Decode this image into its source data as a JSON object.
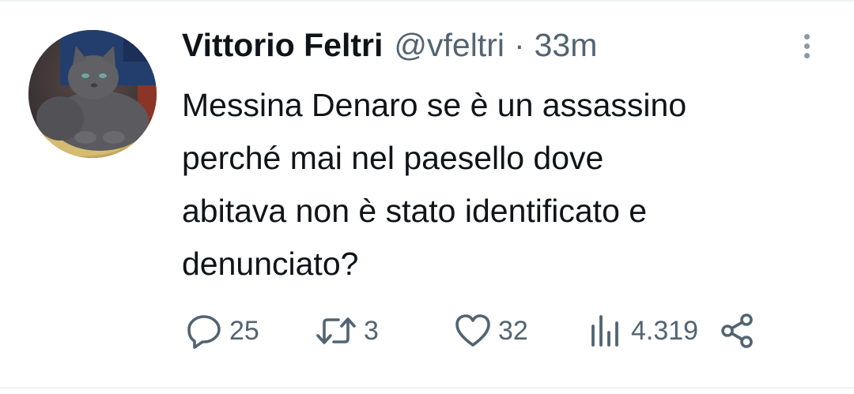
{
  "tweet": {
    "author": {
      "display_name": "Vittorio Feltri",
      "handle": "@vfeltri",
      "avatar_icon": "cat-photo-avatar"
    },
    "separator": "·",
    "timestamp": "33m",
    "text": "Messina Denaro se è un assassino\nperché mai nel paesello dove\nabitava non è stato identificato e\ndenunciato?",
    "menu_icon": "more-vertical-icon",
    "actions": {
      "reply": {
        "icon": "reply-icon",
        "count": "25"
      },
      "retweet": {
        "icon": "retweet-icon",
        "count": "3"
      },
      "like": {
        "icon": "heart-icon",
        "count": "32"
      },
      "views": {
        "icon": "views-chart-icon",
        "count": "4.319"
      },
      "share": {
        "icon": "share-icon"
      }
    },
    "colors": {
      "text_primary": "#0f1419",
      "text_secondary": "#536471",
      "divider": "#eff3f4"
    }
  }
}
